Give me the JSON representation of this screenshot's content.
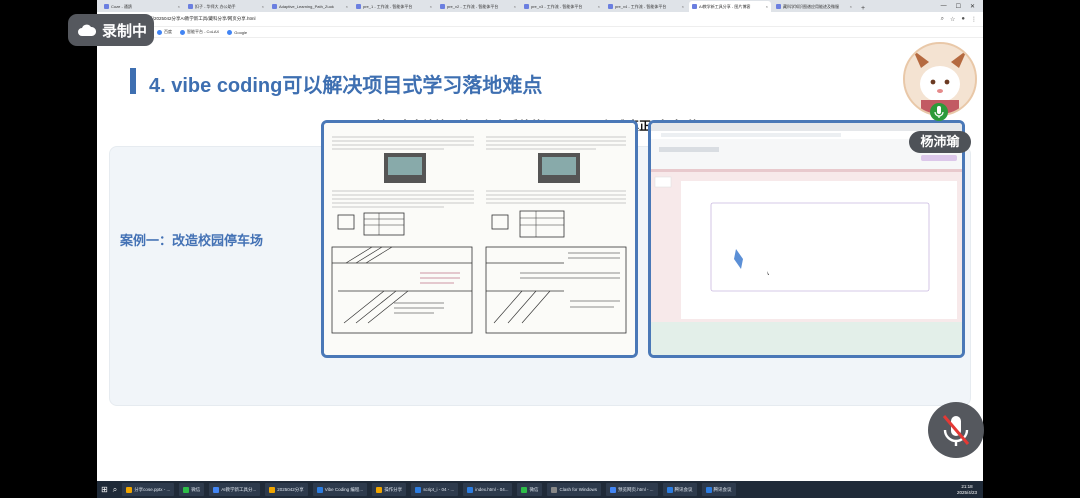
{
  "browser": {
    "tabs": [
      {
        "label": "Coze - 通鹄"
      },
      {
        "label": "扣子 - 华师大 办公助手"
      },
      {
        "label": "Adaptive_Learning_Path_Zuok"
      },
      {
        "label": "pre_1 - 工作流 - 智能体平台"
      },
      {
        "label": "pre_v2 - 工作流 - 智能体平台"
      },
      {
        "label": "pre_v3 - 工作流 - 智能体平台"
      },
      {
        "label": "pre_v4 - 工作流 - 智能体平台"
      },
      {
        "label": "AI教学新工具分享 - 图片博客"
      },
      {
        "label": "藏科学知识图谱应用能迹及微服"
      }
    ],
    "active_tab_index": 7,
    "new_tab": "+",
    "address": "D:/分享/2025042分享AI教学新工具/藏科分享/网页分享.html",
    "bookmarks": [
      {
        "label": "百度"
      },
      {
        "label": "智能平台 - CoLAX"
      },
      {
        "label": "Google"
      }
    ]
  },
  "slide": {
    "title": "4. vibe coding可以解决项目式学习落地难点",
    "quote": "“基于真实情境、涉及复杂系统的问题——是很难真正“实践”的。”",
    "case_label": "案例一：改造校园停车场",
    "accent_color": "#3e6fb1"
  },
  "overlay": {
    "record_label": "录制中",
    "speaker_name": "杨沛瑜",
    "icons": [
      "cloud-icon",
      "microphone-icon",
      "microphone-muted-icon"
    ]
  },
  "taskbar": {
    "items": [
      {
        "label": "分享cose.pptx - ..."
      },
      {
        "label": "微信"
      },
      {
        "label": "AI教学新工具分..."
      },
      {
        "label": "2025042分享"
      },
      {
        "label": "Vibe Coding 编程..."
      },
      {
        "label": "操作分享"
      },
      {
        "label": "script_i - 04 - ..."
      },
      {
        "label": "index.html - 04..."
      },
      {
        "label": "微信"
      },
      {
        "label": "Clash for Windows"
      },
      {
        "label": "预览网页.html - ..."
      },
      {
        "label": "腾讯会议"
      },
      {
        "label": "腾讯会议"
      }
    ],
    "time": "21:18",
    "date": "2025/4/23"
  }
}
